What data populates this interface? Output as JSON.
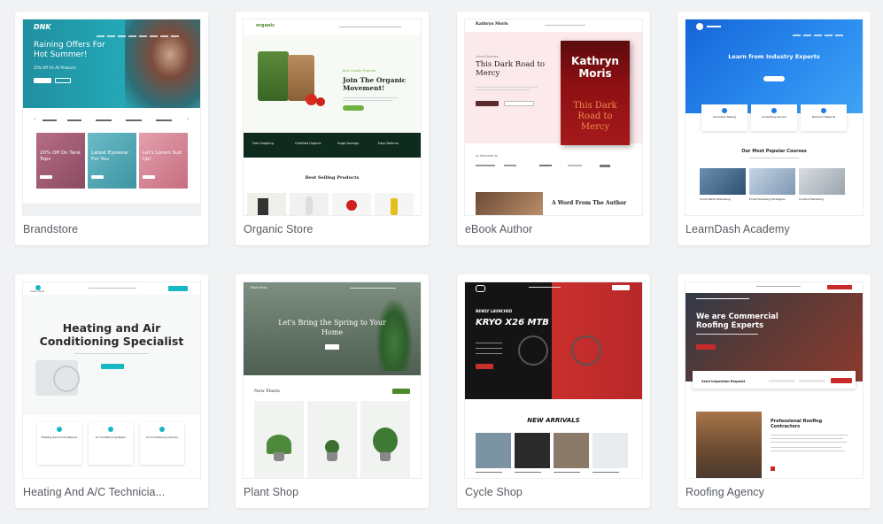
{
  "cards": [
    {
      "label": "Brandstore",
      "preview": {
        "logo": "DNK",
        "headline": "Raining Offers For Hot Summer!",
        "sub": "25% Off On All Products",
        "tile1": "20% Off On Tank Tops",
        "tile2": "Latest Eyewear For You",
        "tile3": "Let's Lorem Suit Up!"
      }
    },
    {
      "label": "Organic Store",
      "preview": {
        "logo": "organic",
        "kicker": "Best Quality Products",
        "headline": "Join The Organic Movement!",
        "features": [
          "Free Shipping",
          "Certified Organic",
          "Huge Savings",
          "Easy Returns"
        ],
        "section": "Best Selling Products"
      }
    },
    {
      "label": "eBook Author",
      "preview": {
        "logo": "Kathryn Moris",
        "kicker": "Latest Release",
        "headline": "This Dark Road to Mercy",
        "book_author": "Kathryn Moris",
        "book_title": "This Dark Road to Mercy",
        "btn1": "BUY THE BOOK",
        "btn2": "FREE PREVIEW",
        "featured": "AS FEATURED IN",
        "section": "A Word From The Author"
      }
    },
    {
      "label": "LearnDash Academy",
      "preview": {
        "headline": "Learn from Industry Experts",
        "features": [
          "Unlimited Testing",
          "Consulting Service",
          "Premium Material"
        ],
        "section": "Our Most Popular Courses",
        "courses": [
          "Social Media Marketing",
          "Email Marketing Strategies",
          "Content Marketing"
        ]
      }
    },
    {
      "label": "Heating And A/C Technicia...",
      "preview": {
        "logo": "classic-devel",
        "headline": "Heating and Air Conditioning Specialist",
        "features": [
          "Heating Service Excellence",
          "Air Conditioning Repair",
          "Air Conditioning Service"
        ]
      }
    },
    {
      "label": "Plant Shop",
      "preview": {
        "logo": "Plant Shop",
        "headline": "Let's Bring the Spring to Your Home",
        "section": "New Plants"
      }
    },
    {
      "label": "Cycle Shop",
      "preview": {
        "kicker": "NEWLY LAUNCHED",
        "headline": "KRYO X26 MTB",
        "section": "NEW ARRIVALS"
      }
    },
    {
      "label": "Roofing Agency",
      "preview": {
        "headline": "We are Commercial Roofing Experts",
        "form_title": "Send Inspection Request",
        "section": "Professional Roofing Contractors"
      }
    }
  ],
  "colors": {
    "page_bg": "#f1f2f4",
    "brand_teal": "#1f9aa8",
    "organic_green": "#6cb33f",
    "dark_green": "#0e2b1d",
    "ebook_pink": "#fbe9ec",
    "book_red": "#8c0f12",
    "learn_blue": "#1e7ae6",
    "cycle_red": "#c9302c",
    "roof_red": "#c92a2a",
    "teal_btn": "#18b7c4"
  }
}
